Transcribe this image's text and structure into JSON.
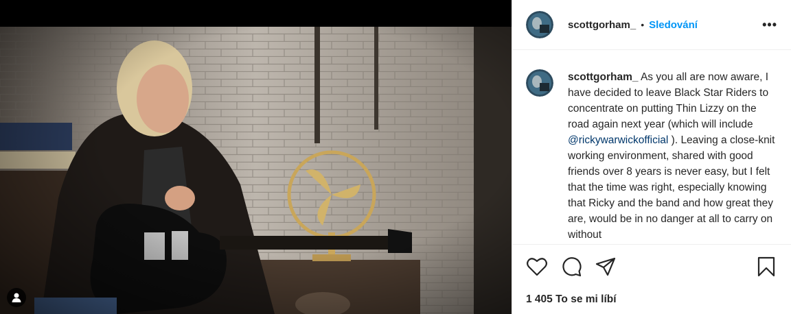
{
  "post": {
    "username": "scottgorham_",
    "follow_label": "Sledování",
    "dot": "•",
    "more_label": "•••"
  },
  "caption": {
    "username": "scottgorham_",
    "text_before": "As you all are now aware, I have decided to leave Black Star Riders to concentrate on putting Thin Lizzy on the road again next year (which will include ",
    "mention": "@rickywarwickofficial",
    "text_after": " ). Leaving a close-knit working environment, shared with good friends over 8 years is never easy, but I felt that the time was right, especially knowing that Ricky and the band and how great they are, would be in no danger at all to carry on without"
  },
  "actions": {
    "icons": [
      "heart-icon",
      "comment-icon",
      "share-icon",
      "bookmark-icon"
    ]
  },
  "likes": {
    "count": "1 405",
    "label": "To se mi líbí"
  }
}
